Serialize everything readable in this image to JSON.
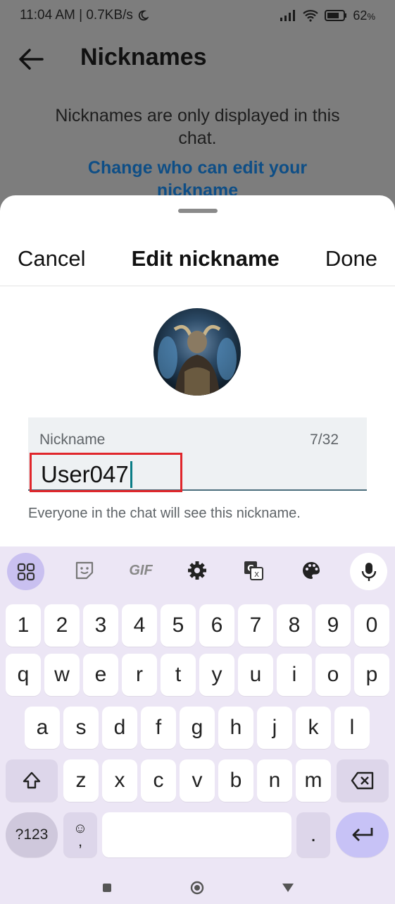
{
  "status_bar": {
    "left_text": "11:04 AM | 0.7KB/s",
    "battery_text": "62"
  },
  "background": {
    "title": "Nicknames",
    "info": "Nicknames are only displayed in this chat.",
    "link": "Change who can edit your nickname"
  },
  "sheet": {
    "cancel_label": "Cancel",
    "title": "Edit nickname",
    "done_label": "Done",
    "field_label": "Nickname",
    "field_value": "User047",
    "char_count": "7/32",
    "helper_text": "Everyone in the chat will see this nickname."
  },
  "keyboard": {
    "toolbar": [
      "apps-icon",
      "sticker-icon",
      "GIF",
      "settings-icon",
      "translate-icon",
      "palette-icon",
      "mic-icon"
    ],
    "numbers": [
      "1",
      "2",
      "3",
      "4",
      "5",
      "6",
      "7",
      "8",
      "9",
      "0"
    ],
    "row1": [
      "q",
      "w",
      "e",
      "r",
      "t",
      "y",
      "u",
      "i",
      "o",
      "p"
    ],
    "row2": [
      "a",
      "s",
      "d",
      "f",
      "g",
      "h",
      "j",
      "k",
      "l"
    ],
    "row3": [
      "z",
      "x",
      "c",
      "v",
      "b",
      "n",
      "m"
    ],
    "symbols_label": "?123",
    "emoji_label": "☺",
    "comma_label": ",",
    "period_label": "."
  },
  "colors": {
    "link": "#0e4e86",
    "highlight": "#e0262b",
    "keyboard_bg": "#ece6f5",
    "enter_key": "#c7c2f6"
  }
}
